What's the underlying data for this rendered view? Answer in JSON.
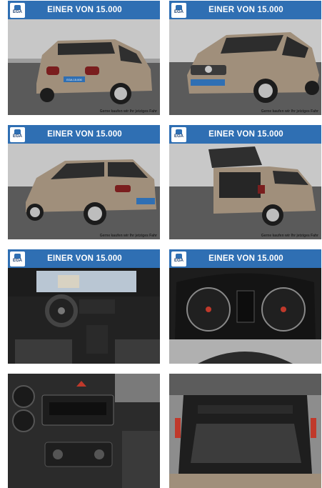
{
  "gallery": {
    "banner_title": "EINER VON 15.000",
    "logo_text": "EGA",
    "caption": "Gerne kaufen wir Ihr jetziges Fahr",
    "plate_text": "EGA 15.000",
    "tiles": [
      {
        "name": "rear-left-view-photo",
        "has_banner": true,
        "has_caption": true
      },
      {
        "name": "front-left-view-photo",
        "has_banner": true,
        "has_caption": true
      },
      {
        "name": "side-rear-view-photo",
        "has_banner": true,
        "has_caption": true
      },
      {
        "name": "open-trunk-view-photo",
        "has_banner": true,
        "has_caption": true
      },
      {
        "name": "dashboard-interior-photo",
        "has_banner": true,
        "has_caption": false
      },
      {
        "name": "instrument-cluster-photo",
        "has_banner": true,
        "has_caption": false
      },
      {
        "name": "center-console-photo",
        "has_banner": false,
        "has_caption": false
      },
      {
        "name": "trunk-interior-photo",
        "has_banner": false,
        "has_caption": false
      }
    ]
  },
  "colors": {
    "banner": "#2f6fb3",
    "car_body": "#a08f7b",
    "background": "#ffffff"
  }
}
